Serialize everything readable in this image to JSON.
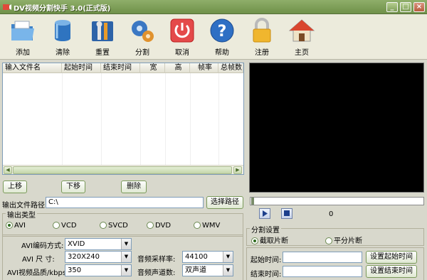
{
  "window": {
    "title": "DV视频分割快手 3.0(正式版)",
    "minimize": "_",
    "maximize": "□",
    "close": "×"
  },
  "toolbar": [
    {
      "label": "添加",
      "icon": "folder-icon"
    },
    {
      "label": "清除",
      "icon": "bucket-icon"
    },
    {
      "label": "重置",
      "icon": "tools-icon"
    },
    {
      "label": "分割",
      "icon": "gears-icon"
    },
    {
      "label": "取消",
      "icon": "power-icon"
    },
    {
      "label": "帮助",
      "icon": "help-icon"
    },
    {
      "label": "注册",
      "icon": "lock-icon"
    },
    {
      "label": "主页",
      "icon": "home-icon"
    }
  ],
  "file_list": {
    "columns": [
      "输入文件名",
      "起始时间",
      "结束时间",
      "宽",
      "高",
      "帧率",
      "总帧数"
    ],
    "rows": []
  },
  "list_buttons": {
    "up": "上移",
    "down": "下移",
    "delete": "删除"
  },
  "output": {
    "path_label": "输出文件路径:",
    "path_value": "C:\\",
    "browse": "选择路径"
  },
  "output_type": {
    "title": "输出类型",
    "options": [
      "AVI",
      "VCD",
      "SVCD",
      "DVD",
      "WMV"
    ],
    "selected": "AVI"
  },
  "encoding": {
    "codec_label": "AVI编码方式:",
    "codec_value": "XVID",
    "size_label": "AVI 尺 寸:",
    "size_value": "320X240",
    "quality_label": "AVI视频品质/kbps:",
    "quality_value": "350",
    "samplerate_label": "音频采样率:",
    "samplerate_value": "44100",
    "channels_label": "音频声道数:",
    "channels_value": "双声道"
  },
  "player": {
    "frame": "0"
  },
  "split": {
    "title": "分割设置",
    "options": [
      "截取片断",
      "平分片断"
    ],
    "selected": "截取片断",
    "start_label": "起始时间:",
    "end_label": "结束时间:",
    "start_value": "",
    "end_value": "",
    "set_start": "设置起始时间",
    "set_end": "设置结束时间"
  }
}
